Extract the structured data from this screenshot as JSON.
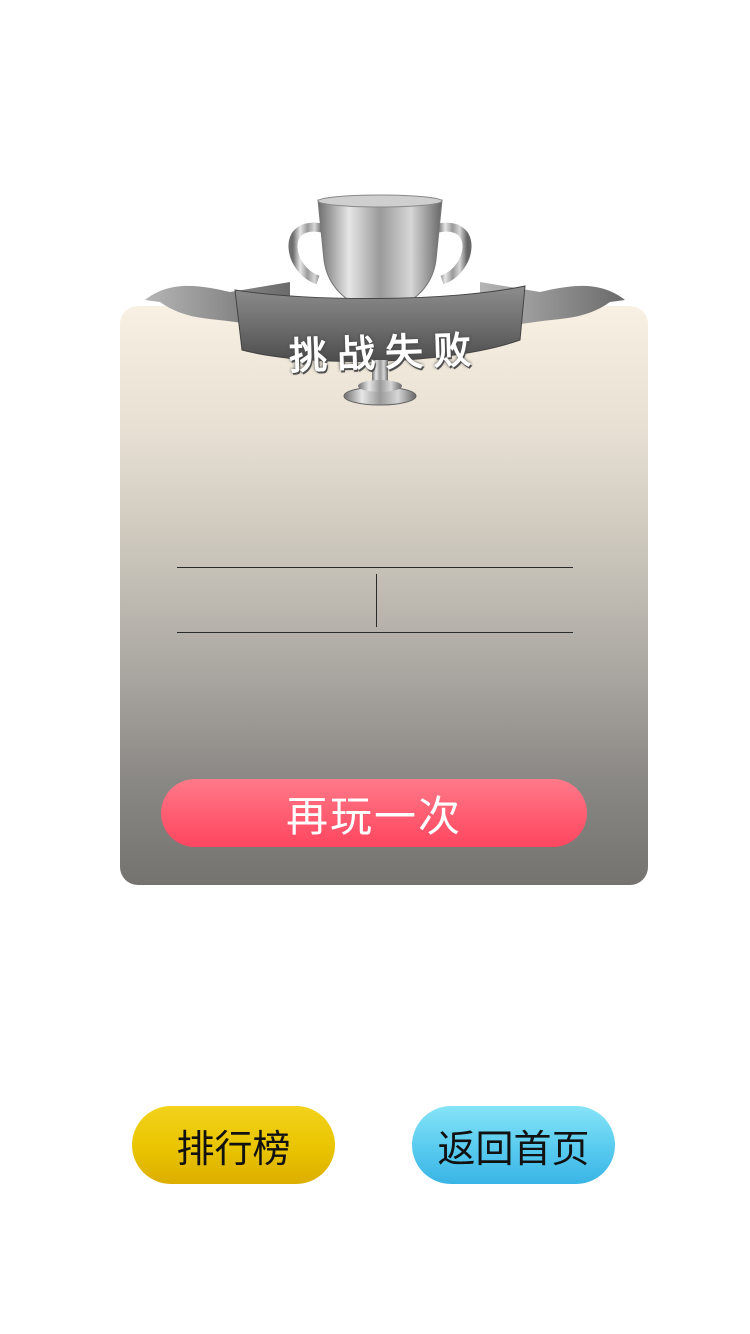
{
  "result": {
    "title": "挑战失败",
    "score_left": "",
    "score_right": ""
  },
  "buttons": {
    "retry_label": "再玩一次",
    "leaderboard_label": "排行榜",
    "home_label": "返回首页"
  },
  "icons": {
    "trophy": "trophy-icon",
    "ribbon": "ribbon-banner"
  },
  "colors": {
    "retry": "#ff5f73",
    "leaderboard": "#e9c400",
    "home": "#5ccdf0",
    "trophy": "#b8b8b8"
  }
}
